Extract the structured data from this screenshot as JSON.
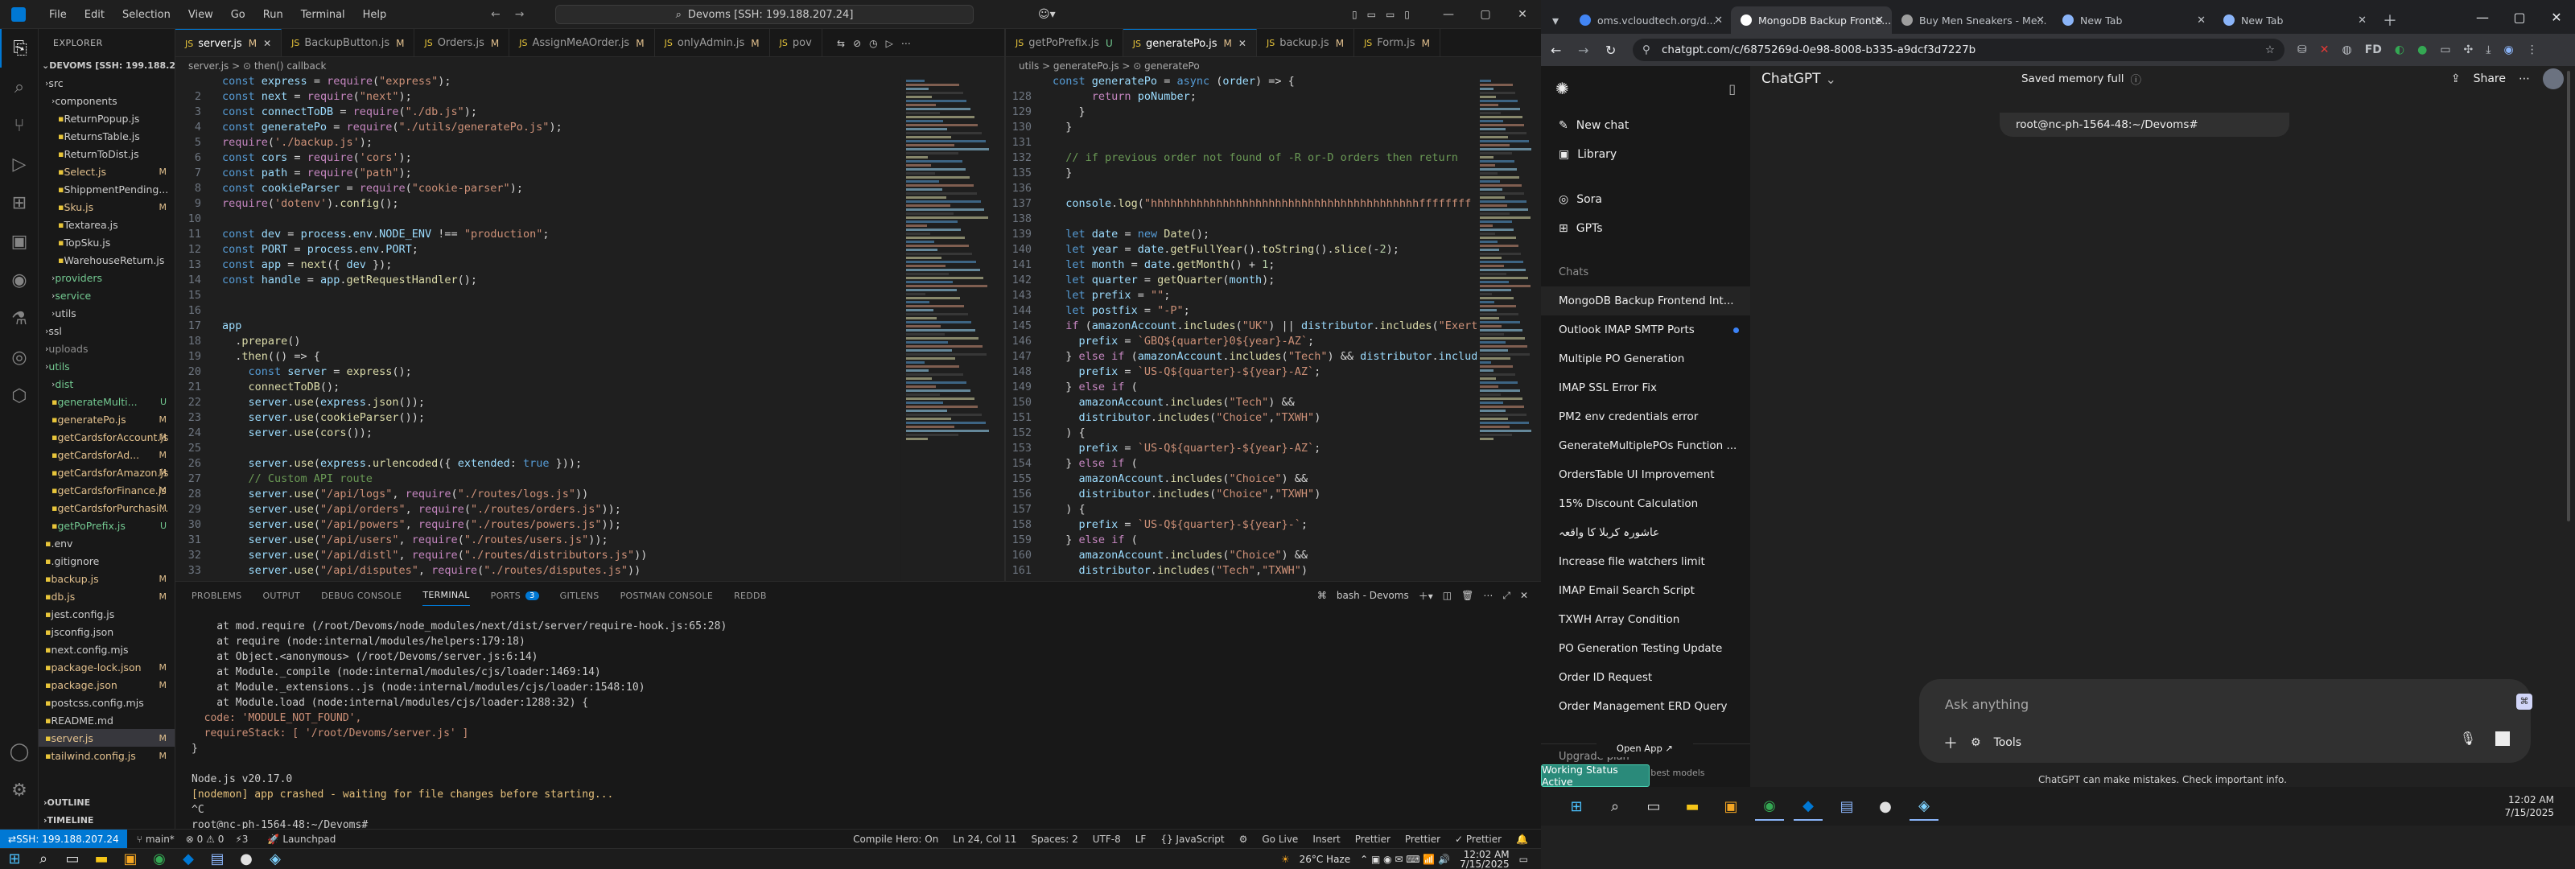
{
  "vscode": {
    "menu": [
      "File",
      "Edit",
      "Selection",
      "View",
      "Go",
      "Run",
      "Terminal",
      "Help"
    ],
    "command_center": "Devoms [SSH: 199.188.207.24]",
    "explorer_title": "EXPLORER",
    "workspace": "DEVOMS [SSH: 199.188.20...",
    "tree": [
      {
        "label": "src",
        "indent": 1,
        "kind": "folder",
        "badge": "",
        "cls": ""
      },
      {
        "label": "components",
        "indent": 2,
        "kind": "folder",
        "badge": "",
        "cls": ""
      },
      {
        "label": "ReturnPopup.js",
        "indent": 3,
        "kind": "file",
        "badge": "",
        "cls": ""
      },
      {
        "label": "ReturnsTable.js",
        "indent": 3,
        "kind": "file",
        "badge": "",
        "cls": ""
      },
      {
        "label": "ReturnToDist.js",
        "indent": 3,
        "kind": "file",
        "badge": "",
        "cls": ""
      },
      {
        "label": "Select.js",
        "indent": 3,
        "kind": "file",
        "badge": "M",
        "cls": "m"
      },
      {
        "label": "ShippmentPending...",
        "indent": 3,
        "kind": "file",
        "badge": "",
        "cls": ""
      },
      {
        "label": "Sku.js",
        "indent": 3,
        "kind": "file",
        "badge": "M",
        "cls": "m"
      },
      {
        "label": "Textarea.js",
        "indent": 3,
        "kind": "file",
        "badge": "",
        "cls": ""
      },
      {
        "label": "TopSku.js",
        "indent": 3,
        "kind": "file",
        "badge": "",
        "cls": ""
      },
      {
        "label": "WarehouseReturn.js",
        "indent": 3,
        "kind": "file",
        "badge": "",
        "cls": ""
      },
      {
        "label": "providers",
        "indent": 2,
        "kind": "folder",
        "badge": "",
        "cls": "g"
      },
      {
        "label": "service",
        "indent": 2,
        "kind": "folder",
        "badge": "",
        "cls": "g"
      },
      {
        "label": "utils",
        "indent": 2,
        "kind": "folder",
        "badge": "",
        "cls": ""
      },
      {
        "label": "ssl",
        "indent": 1,
        "kind": "folder",
        "badge": "",
        "cls": ""
      },
      {
        "label": "uploads",
        "indent": 1,
        "kind": "folder",
        "badge": "",
        "cls": "dim"
      },
      {
        "label": "utils",
        "indent": 1,
        "kind": "folder",
        "badge": "",
        "cls": "g"
      },
      {
        "label": "dist",
        "indent": 2,
        "kind": "folder",
        "badge": "",
        "cls": "g"
      },
      {
        "label": "generateMulti...",
        "indent": 2,
        "kind": "file",
        "badge": "U",
        "cls": "g"
      },
      {
        "label": "generatePo.js",
        "indent": 2,
        "kind": "file",
        "badge": "M",
        "cls": "m"
      },
      {
        "label": "getCardsforAccount.js",
        "indent": 2,
        "kind": "file",
        "badge": "M",
        "cls": "m"
      },
      {
        "label": "getCardsforAd...",
        "indent": 2,
        "kind": "file",
        "badge": "M",
        "cls": "m"
      },
      {
        "label": "getCardsforAmazon.js",
        "indent": 2,
        "kind": "file",
        "badge": "M",
        "cls": "m"
      },
      {
        "label": "getCardsforFinance.js",
        "indent": 2,
        "kind": "file",
        "badge": "M",
        "cls": "m"
      },
      {
        "label": "getCardsforPurchasi...",
        "indent": 2,
        "kind": "file",
        "badge": "M",
        "cls": "m"
      },
      {
        "label": "getPoPrefix.js",
        "indent": 2,
        "kind": "file",
        "badge": "U",
        "cls": "g"
      },
      {
        "label": ".env",
        "indent": 1,
        "kind": "file",
        "badge": "",
        "cls": ""
      },
      {
        "label": ".gitignore",
        "indent": 1,
        "kind": "file",
        "badge": "",
        "cls": ""
      },
      {
        "label": "backup.js",
        "indent": 1,
        "kind": "file",
        "badge": "M",
        "cls": "m"
      },
      {
        "label": "db.js",
        "indent": 1,
        "kind": "file",
        "badge": "M",
        "cls": "m"
      },
      {
        "label": "jest.config.js",
        "indent": 1,
        "kind": "file",
        "badge": "",
        "cls": ""
      },
      {
        "label": "jsconfig.json",
        "indent": 1,
        "kind": "file",
        "badge": "",
        "cls": ""
      },
      {
        "label": "next.config.mjs",
        "indent": 1,
        "kind": "file",
        "badge": "",
        "cls": ""
      },
      {
        "label": "package-lock.json",
        "indent": 1,
        "kind": "file",
        "badge": "M",
        "cls": "m"
      },
      {
        "label": "package.json",
        "indent": 1,
        "kind": "file",
        "badge": "M",
        "cls": "m"
      },
      {
        "label": "postcss.config.mjs",
        "indent": 1,
        "kind": "file",
        "badge": "",
        "cls": ""
      },
      {
        "label": "README.md",
        "indent": 1,
        "kind": "file",
        "badge": "",
        "cls": ""
      },
      {
        "label": "server.js",
        "indent": 1,
        "kind": "file",
        "badge": "M",
        "cls": "m"
      },
      {
        "label": "tailwind.config.js",
        "indent": 1,
        "kind": "file",
        "badge": "M",
        "cls": "m"
      }
    ],
    "outline": "OUTLINE",
    "timeline": "TIMELINE",
    "left_tabs": [
      {
        "label": "server.js",
        "mark": "M",
        "active": true
      },
      {
        "label": "BackupButton.js",
        "mark": "M",
        "active": false
      },
      {
        "label": "Orders.js",
        "mark": "M",
        "active": false
      },
      {
        "label": "AssignMeAOrder.js",
        "mark": "M",
        "active": false
      },
      {
        "label": "onlyAdmin.js",
        "mark": "M",
        "active": false
      },
      {
        "label": "pov",
        "mark": "",
        "active": false
      }
    ],
    "right_tabs": [
      {
        "label": "getPoPrefix.js",
        "mark": "U",
        "active": false
      },
      {
        "label": "generatePo.js",
        "mark": "M",
        "active": true
      },
      {
        "label": "backup.js",
        "mark": "M",
        "active": false
      },
      {
        "label": "Form.js",
        "mark": "M",
        "active": false
      }
    ],
    "left_crumb": "server.js > ⊙ then() callback",
    "right_crumb": "utils > generatePo.js > ⊙ generatePo",
    "left_code": [
      {
        "n": "",
        "t": "const express = require(\"express\");"
      },
      {
        "n": "2",
        "t": "const next = require(\"next\");"
      },
      {
        "n": "3",
        "t": "const connectToDB = require(\"./db.js\");"
      },
      {
        "n": "4",
        "t": "const generatePo = require(\"./utils/generatePo.js\");"
      },
      {
        "n": "5",
        "t": "require('./backup.js');"
      },
      {
        "n": "6",
        "t": "const cors = require('cors');"
      },
      {
        "n": "7",
        "t": "const path = require(\"path\");"
      },
      {
        "n": "8",
        "t": "const cookieParser = require(\"cookie-parser\");"
      },
      {
        "n": "9",
        "t": "require('dotenv').config();"
      },
      {
        "n": "10",
        "t": ""
      },
      {
        "n": "11",
        "t": "const dev = process.env.NODE_ENV !== \"production\";"
      },
      {
        "n": "12",
        "t": "const PORT = process.env.PORT;"
      },
      {
        "n": "13",
        "t": "const app = next({ dev });"
      },
      {
        "n": "14",
        "t": "const handle = app.getRequestHandler();"
      },
      {
        "n": "15",
        "t": ""
      },
      {
        "n": "16",
        "t": ""
      },
      {
        "n": "17",
        "t": "app"
      },
      {
        "n": "18",
        "t": "  .prepare()"
      },
      {
        "n": "19",
        "t": "  .then(() => {"
      },
      {
        "n": "20",
        "t": "    const server = express();"
      },
      {
        "n": "21",
        "t": "    connectToDB();"
      },
      {
        "n": "22",
        "t": "    server.use(express.json());"
      },
      {
        "n": "23",
        "t": "    server.use(cookieParser());"
      },
      {
        "n": "24",
        "t": "    server.use(cors());"
      },
      {
        "n": "25",
        "t": ""
      },
      {
        "n": "26",
        "t": "    server.use(express.urlencoded({ extended: true }));"
      },
      {
        "n": "27",
        "t": "    // Custom API route"
      },
      {
        "n": "28",
        "t": "    server.use(\"/api/logs\", require(\"./routes/logs.js\"))"
      },
      {
        "n": "29",
        "t": "    server.use(\"/api/orders\", require(\"./routes/orders.js\"));"
      },
      {
        "n": "30",
        "t": "    server.use(\"/api/powers\", require(\"./routes/powers.js\"));"
      },
      {
        "n": "31",
        "t": "    server.use(\"/api/users\", require(\"./routes/users.js\"));"
      },
      {
        "n": "32",
        "t": "    server.use(\"/api/distl\", require(\"./routes/distributors.js\"))"
      },
      {
        "n": "33",
        "t": "    server.use(\"/api/disputes\", require(\"./routes/disputes.js\"))"
      }
    ],
    "right_code": [
      {
        "n": "",
        "t": "const generatePo = async (order) => {"
      },
      {
        "n": "128",
        "t": "      return poNumber;"
      },
      {
        "n": "129",
        "t": "    }"
      },
      {
        "n": "130",
        "t": "  }"
      },
      {
        "n": "131",
        "t": ""
      },
      {
        "n": "132",
        "t": "  // if previous order not found of -R or-D orders then return"
      },
      {
        "n": "135",
        "t": "  }"
      },
      {
        "n": "136",
        "t": ""
      },
      {
        "n": "137",
        "t": "  console.log(\"hhhhhhhhhhhhhhhhhhhhhhhhhhhhhhhhhhhhhhhhhffffffff"
      },
      {
        "n": "138",
        "t": ""
      },
      {
        "n": "139",
        "t": "  let date = new Date();"
      },
      {
        "n": "140",
        "t": "  let year = date.getFullYear().toString().slice(-2);"
      },
      {
        "n": "141",
        "t": "  let month = date.getMonth() + 1;"
      },
      {
        "n": "142",
        "t": "  let quarter = getQuarter(month);"
      },
      {
        "n": "143",
        "t": "  let prefix = \"\";"
      },
      {
        "n": "144",
        "t": "  let postfix = \"-P\";"
      },
      {
        "n": "145",
        "t": "  if (amazonAccount.includes(\"UK\") || distributor.includes(\"Exert"
      },
      {
        "n": "146",
        "t": "    prefix = `GBQ${quarter}0${year}-AZ`;"
      },
      {
        "n": "147",
        "t": "  } else if (amazonAccount.includes(\"Tech\") && distributor.include"
      },
      {
        "n": "148",
        "t": "    prefix = `US-Q${quarter}-${year}-AZ`;"
      },
      {
        "n": "149",
        "t": "  } else if ("
      },
      {
        "n": "150",
        "t": "    amazonAccount.includes(\"Tech\") &&"
      },
      {
        "n": "151",
        "t": "    distributor.includes(\"Choice\",\"TXWH\")"
      },
      {
        "n": "152",
        "t": "  ) {"
      },
      {
        "n": "153",
        "t": "    prefix = `US-Q${quarter}-${year}-AZ`;"
      },
      {
        "n": "154",
        "t": "  } else if ("
      },
      {
        "n": "155",
        "t": "    amazonAccount.includes(\"Choice\") &&"
      },
      {
        "n": "156",
        "t": "    distributor.includes(\"Choice\",\"TXWH\")"
      },
      {
        "n": "157",
        "t": "  ) {"
      },
      {
        "n": "158",
        "t": "    prefix = `US-Q${quarter}-${year}-`;"
      },
      {
        "n": "159",
        "t": "  } else if ("
      },
      {
        "n": "160",
        "t": "    amazonAccount.includes(\"Choice\") &&"
      },
      {
        "n": "161",
        "t": "    distributor.includes(\"Tech\",\"TXWH\")"
      }
    ],
    "panel_tabs": [
      "PROBLEMS",
      "OUTPUT",
      "DEBUG CONSOLE",
      "TERMINAL",
      "PORTS",
      "GITLENS",
      "POSTMAN CONSOLE",
      "REDDB"
    ],
    "ports_badge": "3",
    "terminal_shell": "bash - Devoms",
    "terminal": [
      "    at mod.require (/root/Devoms/node_modules/next/dist/server/require-hook.js:65:28)",
      "    at require (node:internal/modules/helpers:179:18)",
      "    at Object.<anonymous> (/root/Devoms/server.js:6:14)",
      "    at Module._compile (node:internal/modules/cjs/loader:1469:14)",
      "    at Module._extensions..js (node:internal/modules/cjs/loader:1548:10)",
      "    at Module.load (node:internal/modules/cjs/loader:1288:32) {",
      "  code: 'MODULE_NOT_FOUND',",
      "  requireStack: [ '/root/Devoms/server.js' ]",
      "}",
      "",
      "Node.js v20.17.0",
      "[nodemon] app crashed - waiting for file changes before starting...",
      "^C",
      "root@nc-ph-1564-48:~/Devoms# "
    ],
    "status": {
      "remote": "SSH: 199.188.207.24",
      "branch": "main*",
      "errors": "⊗ 0 ⚠ 0",
      "ports": "⚡3",
      "launchpad": "Launchpad",
      "compile": "Compile Hero: On",
      "position": "Ln 24, Col 11",
      "spaces": "Spaces: 2",
      "encoding": "UTF-8",
      "eol": "LF",
      "language": "{} JavaScript",
      "golive": "Go Live",
      "insert": "Insert",
      "prettier1": "Prettier",
      "prettier2": "Prettier",
      "prettier3": "✓ Prettier"
    },
    "taskbar": {
      "weather": "26°C  Haze",
      "time": "12:02 AM",
      "date": "7/15/2025"
    }
  },
  "chrome": {
    "tabs": [
      {
        "label": "oms.vcloudtech.org/d...",
        "active": false,
        "fav": "#4285f4"
      },
      {
        "label": "MongoDB Backup Fronte...",
        "active": true,
        "fav": "#ffffff"
      },
      {
        "label": "Buy Men Sneakers - Me...",
        "active": false,
        "fav": "#9e9e9e"
      },
      {
        "label": "New Tab",
        "active": false,
        "fav": "#8ab4f8"
      },
      {
        "label": "New Tab",
        "active": false,
        "fav": "#8ab4f8"
      }
    ],
    "url": "chatgpt.com/c/6875269d-0e98-8008-b335-a9dcf3d7227b",
    "gpt": {
      "model": "ChatGPT",
      "memory": "Saved memory full",
      "share": "Share",
      "nav": [
        "New chat",
        "Library",
        "Sora",
        "GPTs"
      ],
      "chats_header": "Chats",
      "chats": [
        "MongoDB Backup Frontend Int...",
        "Outlook IMAP SMTP Ports",
        "Multiple PO Generation",
        "IMAP SSL Error Fix",
        "PM2 env credentials error",
        "GenerateMultiplePOs Function ...",
        "OrdersTable UI Improvement",
        "15% Discount Calculation",
        "عاشورہ کربلا کا واقعہ",
        "Increase file watchers limit",
        "IMAP Email Search Script",
        "TXWH Array Condition",
        "PO Generation Testing Update",
        "Order ID Request",
        "Order Management ERD Query"
      ],
      "prompt_chip": "root@nc-ph-1564-48:~/Devoms#",
      "composer_placeholder": "Ask anything",
      "tools": "Tools",
      "disclaimer": "ChatGPT can make mistakes. Check important info.",
      "open_app": "Open App ↗",
      "upgrade": "Upgrade plan",
      "upgrade_sub": "...s to best models",
      "working_toast": "Working Status Active"
    },
    "taskbar": {
      "time": "12:02 AM",
      "date": "7/15/2025"
    }
  }
}
